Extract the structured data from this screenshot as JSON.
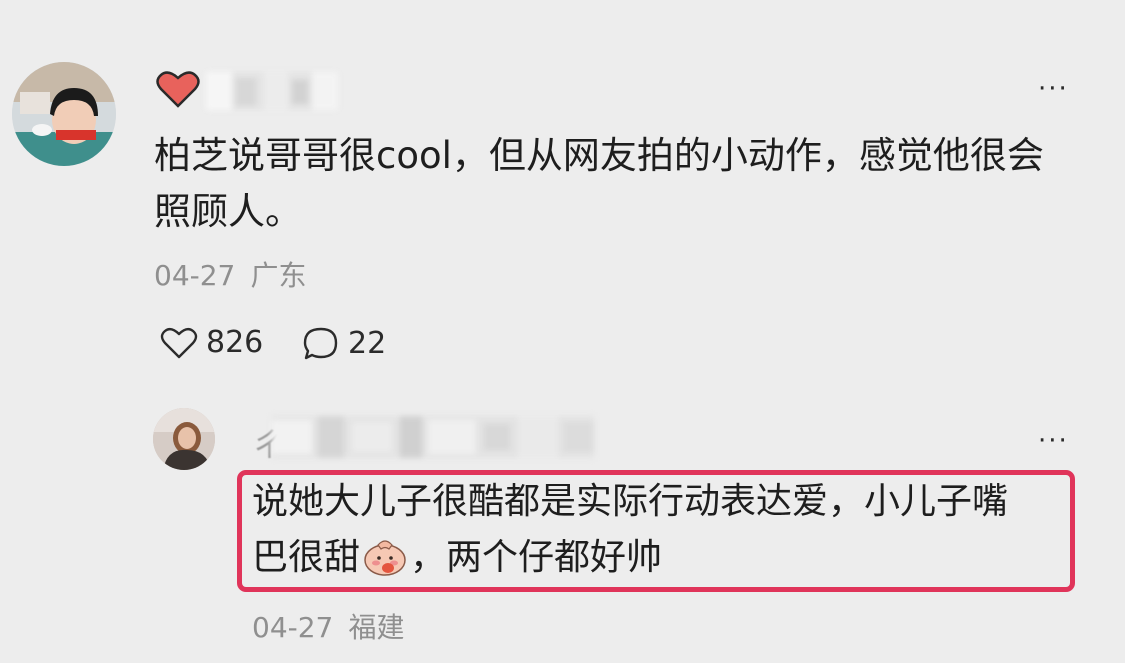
{
  "comment": {
    "text": "柏芝说哥哥很cool，但从网友拍的小动作，感觉他很会\n照顾人。",
    "date": "04-27",
    "location": "广东",
    "likes": "826",
    "replies": "22",
    "more_label": "···"
  },
  "reply": {
    "text_part1": "说她大儿子很酷都是实际行动表达爱，小儿子嘴",
    "text_part2_before_emoji": "巴很甜",
    "text_part2_after_emoji": "，两个仔都好帅",
    "date": "04-27",
    "location": "福建",
    "more_label": "···",
    "name_partial": "ㄔ"
  },
  "icons": {
    "badge": "heart-badge-icon",
    "like": "heart-outline-icon",
    "reply": "speech-bubble-icon",
    "emoji": "blushing-emoji-icon"
  },
  "colors": {
    "background": "#ededed",
    "highlight_border": "#e0345a",
    "meta_text": "#8f8f8f",
    "heart_badge": "#e8625c"
  }
}
